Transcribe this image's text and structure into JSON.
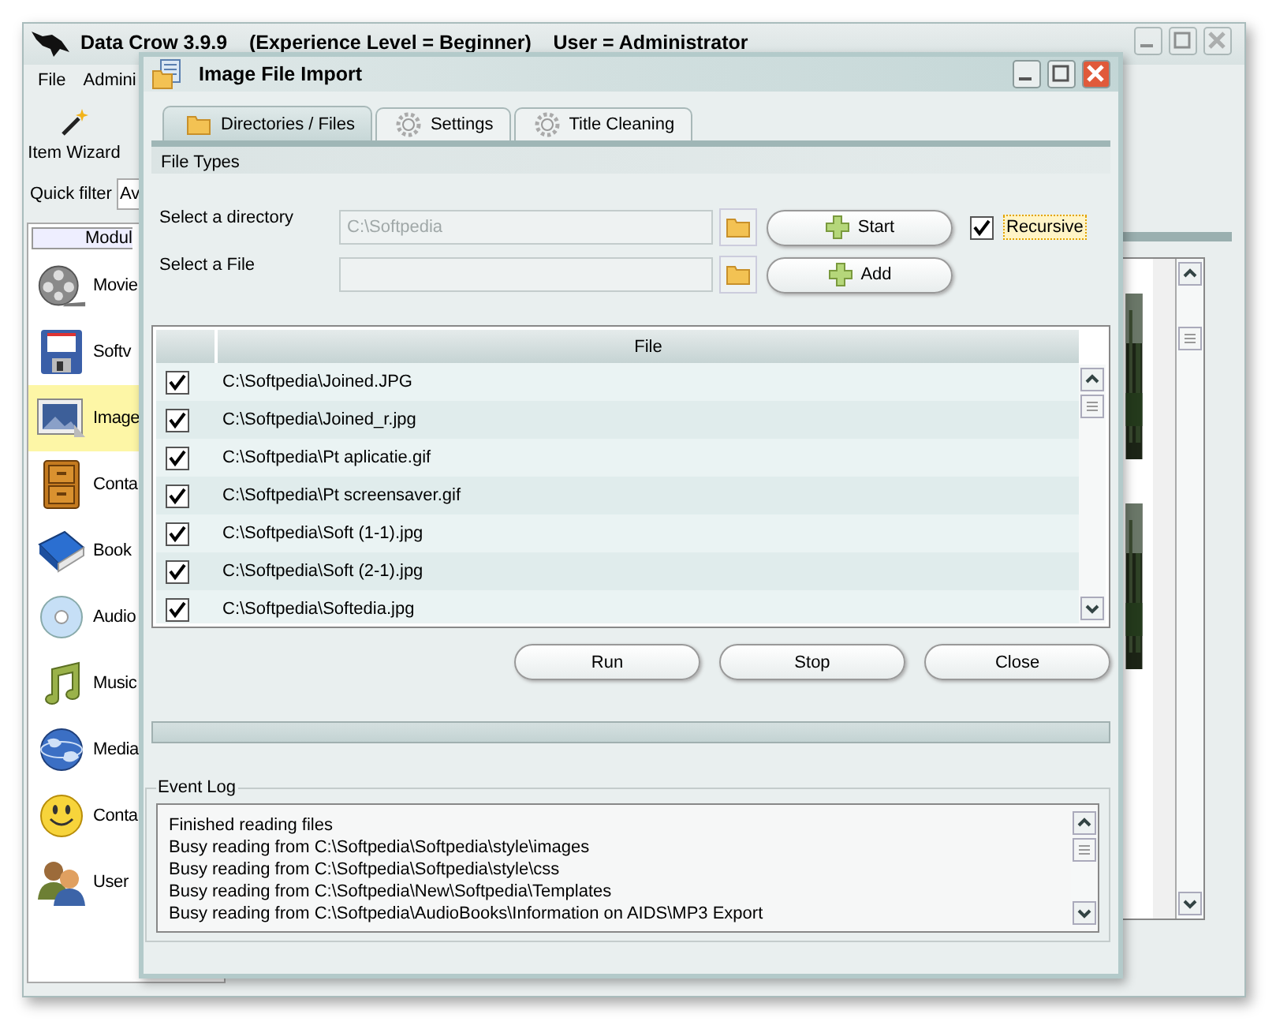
{
  "main_window": {
    "title": "Data Crow 3.9.9    (Experience Level = Beginner)    User = Administrator",
    "menu": [
      "File",
      "Admini"
    ],
    "toolbar": [
      {
        "label": "Item Wizard"
      }
    ],
    "quick_filter": {
      "label": "Quick filter",
      "value": "Av"
    },
    "modules": {
      "header": "Modul",
      "items": [
        {
          "label": "Movie",
          "kind": "film",
          "selected": false
        },
        {
          "label": "Softv",
          "kind": "floppy",
          "selected": false
        },
        {
          "label": "Image",
          "kind": "picture",
          "selected": true
        },
        {
          "label": "Conta",
          "kind": "cabinet",
          "selected": false
        },
        {
          "label": "Book",
          "kind": "book",
          "selected": false
        },
        {
          "label": "Audio",
          "kind": "disc",
          "selected": false
        },
        {
          "label": "Music",
          "kind": "music",
          "selected": false
        },
        {
          "label": "Media",
          "kind": "globe",
          "selected": false
        },
        {
          "label": "Conta",
          "kind": "smiley",
          "selected": false
        },
        {
          "label": "User",
          "kind": "users",
          "selected": false
        }
      ]
    }
  },
  "dialog": {
    "title": "Image File Import",
    "tabs": [
      {
        "label": "Directories / Files",
        "kind": "folder",
        "selected": true
      },
      {
        "label": "Settings",
        "kind": "gear",
        "selected": false
      },
      {
        "label": "Title Cleaning",
        "kind": "gear",
        "selected": false
      }
    ],
    "section": "File Types",
    "directory": {
      "label": "Select a directory",
      "value": "C:\\Softpedia",
      "disabled": true
    },
    "file": {
      "label": "Select a File"
    },
    "start_button": "Start",
    "add_button": "Add",
    "recursive": {
      "label": "Recursive",
      "checked": true
    },
    "table": {
      "columns": [
        "File"
      ],
      "rows": [
        {
          "checked": true,
          "file": "C:\\Softpedia\\Joined.JPG"
        },
        {
          "checked": true,
          "file": "C:\\Softpedia\\Joined_r.jpg"
        },
        {
          "checked": true,
          "file": "C:\\Softpedia\\Pt aplicatie.gif"
        },
        {
          "checked": true,
          "file": "C:\\Softpedia\\Pt screensaver.gif"
        },
        {
          "checked": true,
          "file": "C:\\Softpedia\\Soft (1-1).jpg"
        },
        {
          "checked": true,
          "file": "C:\\Softpedia\\Soft (2-1).jpg"
        },
        {
          "checked": true,
          "file": "C:\\Softpedia\\Softedia.jpg"
        }
      ]
    },
    "buttons": [
      "Run",
      "Stop",
      "Close"
    ],
    "progress": {
      "level": 0
    },
    "event_log": {
      "title": "Event Log",
      "lines": [
        "Finished reading files",
        "Busy reading from C:\\Softpedia\\Softpedia\\style\\images",
        "Busy reading from C:\\Softpedia\\Softpedia\\style\\css",
        "Busy reading from C:\\Softpedia\\New\\Softpedia\\Templates",
        "Busy reading from C:\\Softpedia\\AudioBooks\\Information on AIDS\\MP3 Export"
      ]
    }
  }
}
